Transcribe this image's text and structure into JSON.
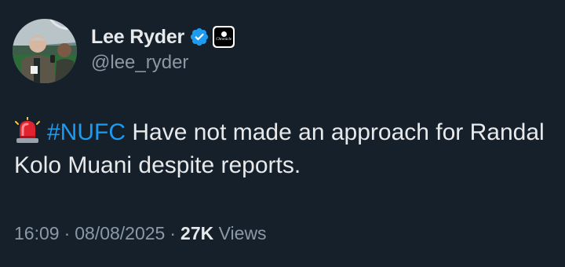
{
  "author": {
    "display_name": "Lee Ryder",
    "handle": "@lee_ryder",
    "verified": true,
    "affiliation_badge_text": "Chronicle"
  },
  "tweet": {
    "emoji": "siren-icon",
    "hashtag": "#NUFC",
    "text": " Have not made an approach for Randal Kolo Muani despite reports."
  },
  "meta": {
    "time": "16:09",
    "separator": "·",
    "date": "08/08/2025",
    "views_count": "27K",
    "views_label": "Views"
  },
  "colors": {
    "background": "#15202b",
    "text": "#e7e9ea",
    "secondary": "#8b98a5",
    "link": "#1d9bf0",
    "verified": "#1d9bf0"
  }
}
